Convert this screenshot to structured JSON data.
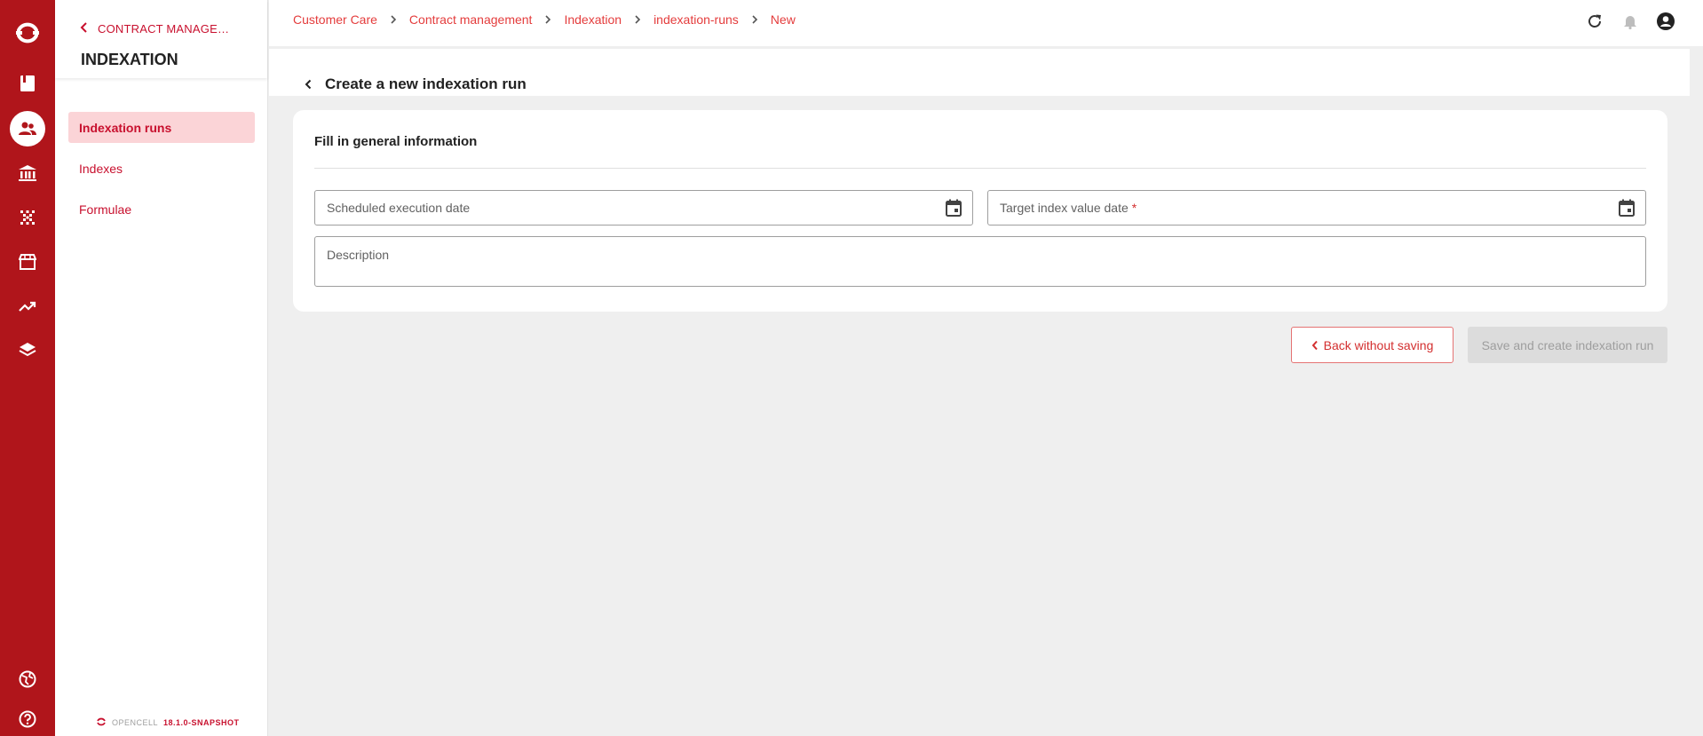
{
  "rail": {
    "items": [
      {
        "icon": "book-icon"
      },
      {
        "icon": "customers-icon",
        "active": true
      },
      {
        "icon": "bank-icon"
      },
      {
        "icon": "network-icon"
      },
      {
        "icon": "store-icon"
      },
      {
        "icon": "trending-icon"
      },
      {
        "icon": "layers-icon"
      }
    ],
    "bottom": [
      {
        "icon": "globe-icon"
      },
      {
        "icon": "help-icon"
      }
    ]
  },
  "side": {
    "back_label": "CONTRACT MANAGEMENT",
    "title": "INDEXATION",
    "items": [
      {
        "label": "Indexation runs",
        "active": true
      },
      {
        "label": "Indexes"
      },
      {
        "label": "Formulae"
      }
    ],
    "footer": {
      "brand": "OPENCELL",
      "version": "18.1.0-SNAPSHOT"
    }
  },
  "breadcrumb": [
    "Customer Care",
    "Contract management",
    "Indexation",
    "indexation-runs",
    "New"
  ],
  "header": {
    "title": "Create a new indexation run"
  },
  "form": {
    "section_title": "Fill in general information",
    "scheduled_label": "Scheduled execution date",
    "target_label": "Target index value date",
    "required_mark": "*",
    "description_label": "Description"
  },
  "actions": {
    "back_label": "Back without saving",
    "save_label": "Save and create indexation run"
  },
  "colors": {
    "accent": "#b0151b",
    "link": "#e43c3c",
    "active_bg": "#fbd4d7"
  }
}
